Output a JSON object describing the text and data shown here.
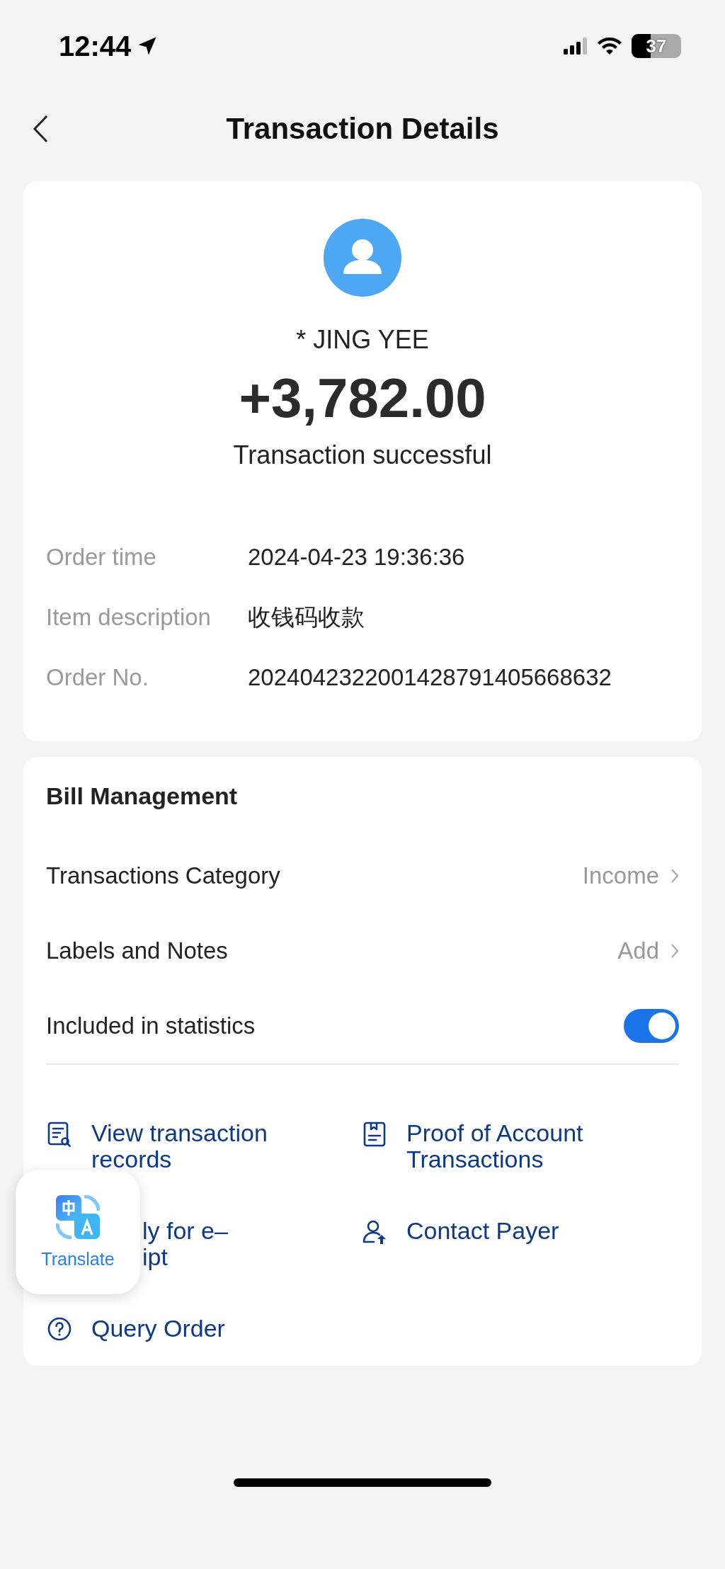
{
  "status_bar": {
    "time": "12:44",
    "battery": "37"
  },
  "header": {
    "title": "Transaction Details"
  },
  "summary": {
    "payer": "* JING YEE",
    "amount": "+3,782.00",
    "status": "Transaction successful",
    "details": [
      {
        "label": "Order time",
        "value": "2024-04-23 19:36:36"
      },
      {
        "label": "Item description",
        "value": "收钱码收款"
      },
      {
        "label": "Order No.",
        "value": "2024042322001428791405668632"
      }
    ]
  },
  "bill_management": {
    "title": "Bill Management",
    "rows": [
      {
        "kind": "link",
        "label": "Transactions Category",
        "value": "Income"
      },
      {
        "kind": "link",
        "label": "Labels and Notes",
        "value": "Add"
      },
      {
        "kind": "toggle",
        "label": "Included in statistics",
        "on": true
      }
    ],
    "actions": [
      {
        "kind": "records",
        "lines": [
          "View transaction",
          "records"
        ]
      },
      {
        "kind": "proof",
        "lines": [
          "Proof of Account",
          "Transactions"
        ]
      },
      {
        "kind": "covered",
        "lines": [
          "ly for e–",
          "ipt"
        ]
      },
      {
        "kind": "contact",
        "lines": [
          "Contact Payer"
        ]
      },
      {
        "kind": "query",
        "lines": [
          "Query Order"
        ]
      }
    ]
  },
  "translate_button": {
    "label": "Translate"
  }
}
